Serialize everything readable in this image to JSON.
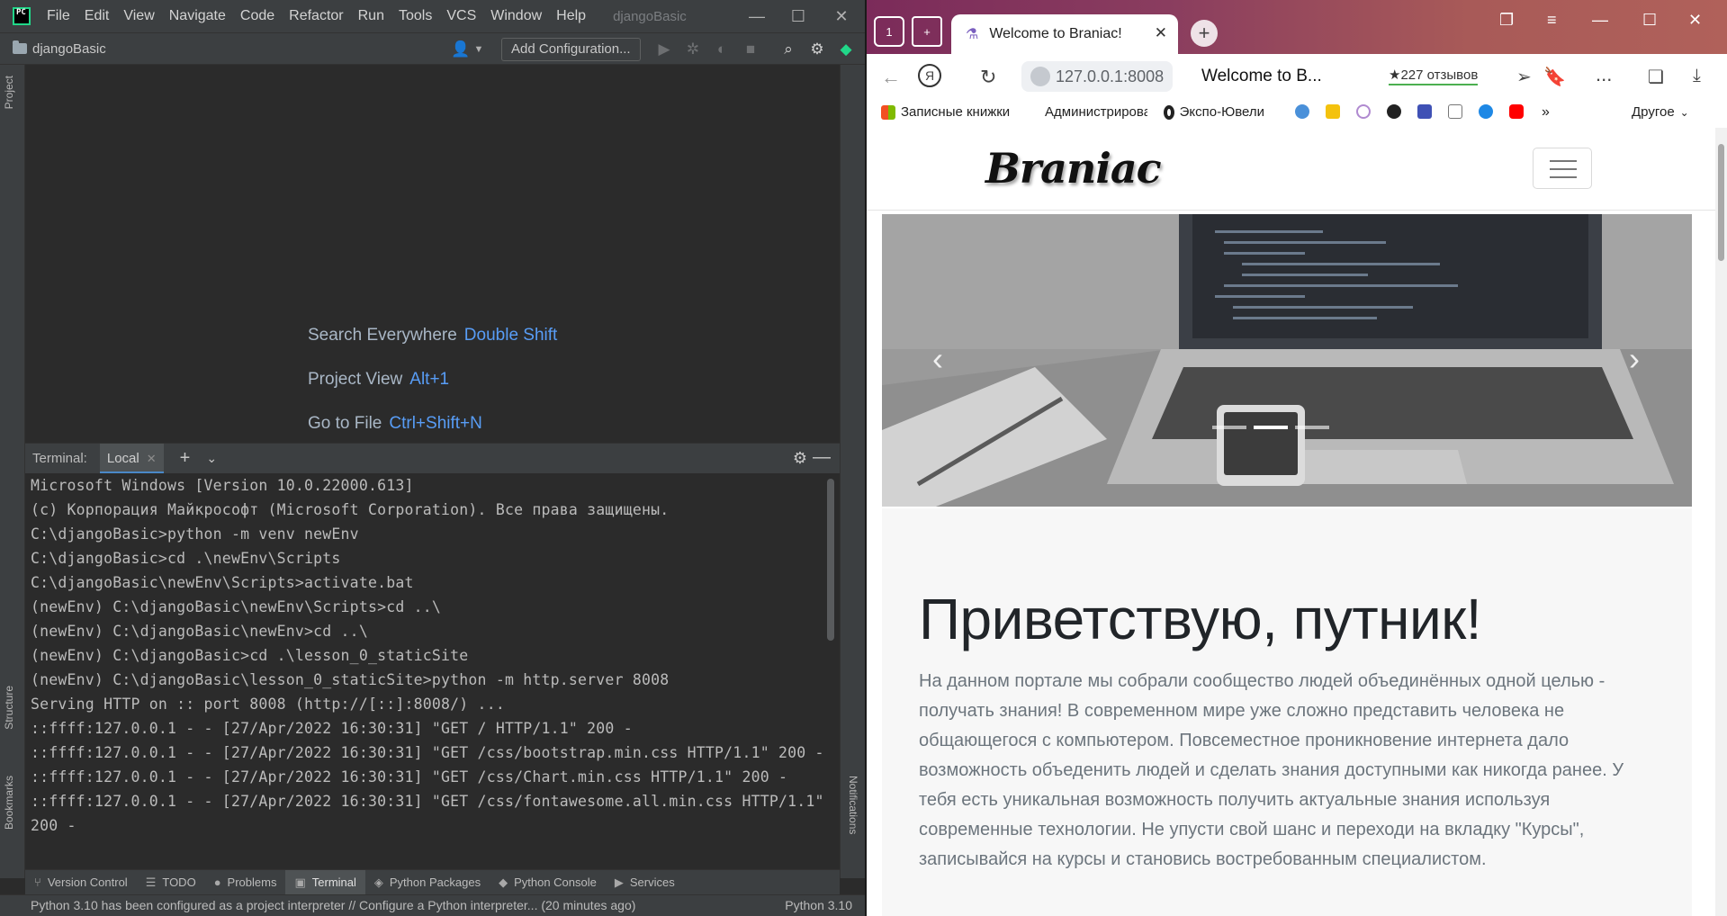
{
  "ide": {
    "menu": [
      "File",
      "Edit",
      "View",
      "Navigate",
      "Code",
      "Refactor",
      "Run",
      "Tools",
      "VCS",
      "Window",
      "Help"
    ],
    "project_title": "djangoBasic",
    "breadcrumb": "djangoBasic",
    "add_config_label": "Add Configuration...",
    "left_tabs": [
      "Project",
      "Structure",
      "Bookmarks"
    ],
    "right_tabs": [
      "Notifications"
    ],
    "hints": [
      {
        "label": "Search Everywhere",
        "key": "Double Shift"
      },
      {
        "label": "Project View",
        "key": "Alt+1"
      },
      {
        "label": "Go to File",
        "key": "Ctrl+Shift+N"
      }
    ],
    "terminal": {
      "label": "Terminal:",
      "tab": "Local",
      "lines": [
        "Microsoft Windows [Version 10.0.22000.613]",
        "(c) Корпорация Майкрософт (Microsoft Corporation). Все права защищены.",
        "C:\\djangoBasic>python -m venv newEnv",
        "C:\\djangoBasic>cd .\\newEnv\\Scripts",
        "C:\\djangoBasic\\newEnv\\Scripts>activate.bat",
        "(newEnv) C:\\djangoBasic\\newEnv\\Scripts>cd ..\\",
        "(newEnv) C:\\djangoBasic\\newEnv>cd ..\\",
        "(newEnv) C:\\djangoBasic>cd .\\lesson_0_staticSite",
        "(newEnv) C:\\djangoBasic\\lesson_0_staticSite>python -m http.server 8008",
        "Serving HTTP on :: port 8008 (http://[::]:8008/) ...",
        "::ffff:127.0.0.1 - - [27/Apr/2022 16:30:31] \"GET / HTTP/1.1\" 200 -",
        "::ffff:127.0.0.1 - - [27/Apr/2022 16:30:31] \"GET /css/bootstrap.min.css HTTP/1.1\" 200 -",
        "::ffff:127.0.0.1 - - [27/Apr/2022 16:30:31] \"GET /css/Chart.min.css HTTP/1.1\" 200 -",
        "::ffff:127.0.0.1 - - [27/Apr/2022 16:30:31] \"GET /css/fontawesome.all.min.css HTTP/1.1\"",
        "200 -"
      ]
    },
    "tool_tabs": [
      {
        "label": "Version Control",
        "icon": "branch-icon"
      },
      {
        "label": "TODO",
        "icon": "list-icon"
      },
      {
        "label": "Problems",
        "icon": "problems-icon"
      },
      {
        "label": "Terminal",
        "icon": "terminal-icon"
      },
      {
        "label": "Python Packages",
        "icon": "packages-icon"
      },
      {
        "label": "Python Console",
        "icon": "console-icon"
      },
      {
        "label": "Services",
        "icon": "services-icon"
      }
    ],
    "status_left": "Python 3.10 has been configured as a project interpreter // Configure a Python interpreter... (20 minutes ago)",
    "status_right": "Python 3.10"
  },
  "browser": {
    "tab_title": "Welcome to Braniac!",
    "tab_counter": "1",
    "url": "127.0.0.1:8008",
    "page_title": "Welcome to B...",
    "reviews": "★227 отзывов",
    "bookmarks": [
      "Записные книжки",
      "Администрирова",
      "Экспо-Ювели"
    ],
    "bookmarks_other": "Другое",
    "more_label": "...",
    "colors": {
      "tabbar_start": "#7b2b5a",
      "tabbar_end": "#b0615a",
      "ide_accent": "#589df6"
    }
  },
  "site": {
    "logo": "Braniac",
    "hero_title": "Приветствую, путник!",
    "hero_text": "На данном портале мы собрали сообщество людей объединённых одной целью - получать знания! В современном мире уже сложно представить человека не общающегося с компьютером. Повсеместное проникновение интернета дало возможность объеденить людей и сделать знания доступными как никогда ранее. У тебя есть уникальная возможность получить актуальные знания используя современные технологии. Не упусти свой шанс и переходи на вкладку \"Курсы\", записывайся на курсы и становись востребованным специалистом."
  }
}
